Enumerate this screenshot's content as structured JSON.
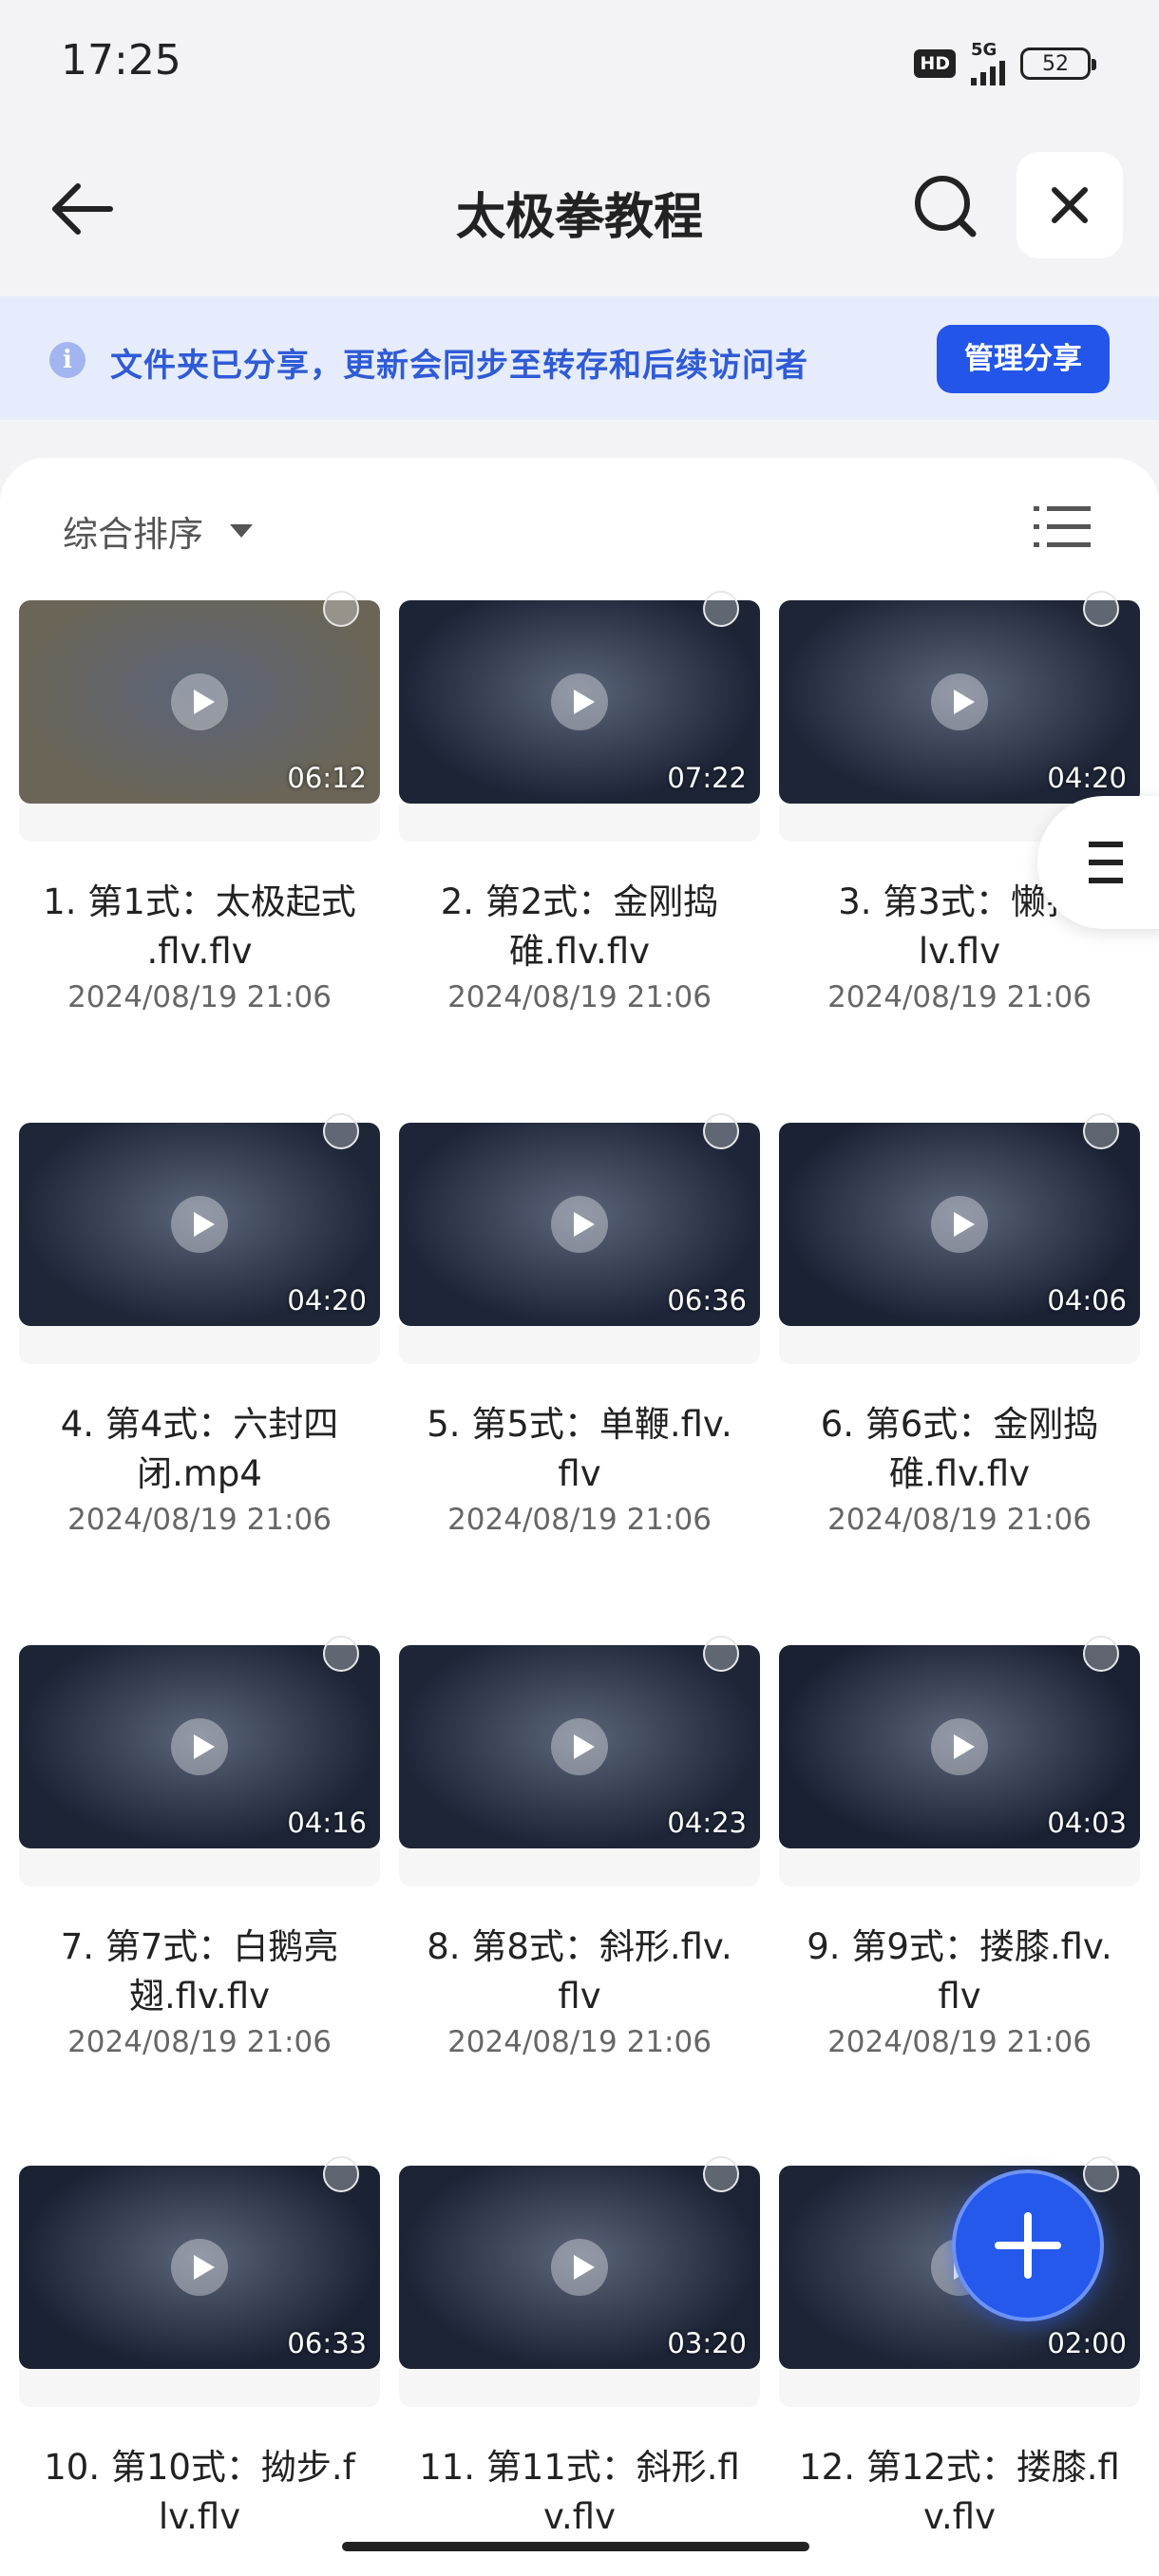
{
  "status_bar": {
    "time": "17:25",
    "hd_badge": "HD",
    "network": "5G",
    "battery": "52"
  },
  "header": {
    "title": "太极拳教程",
    "back_icon": "arrow-left-icon",
    "search_icon": "search-icon",
    "close_icon": "close-icon"
  },
  "banner": {
    "text": "文件夹已分享，更新会同步至转存和后续访问者",
    "button": "管理分享"
  },
  "sort": {
    "label": "综合排序"
  },
  "files": [
    {
      "name": "1. 第1式：太极起式.flv.flv",
      "line1": "1. 第1式：太极起式",
      "line2": ".flv.flv",
      "date": "2024/08/19 21:06",
      "duration": "06:12",
      "thumb_color": "#6b6558"
    },
    {
      "name": "2. 第2式：金刚捣碓.flv.flv",
      "line1": "2. 第2式：金刚捣",
      "line2": "碓.flv.flv",
      "date": "2024/08/19 21:06",
      "duration": "07:22",
      "thumb_color": "#1c2436"
    },
    {
      "name": "3. 第3式：懒扎衣.flv.flv",
      "line1": "3. 第3式：懒扎",
      "line2": "lv.flv",
      "date": "2024/08/19 21:06",
      "duration": "04:20",
      "thumb_color": "#1e2537"
    },
    {
      "name": "4. 第4式：六封四闭.mp4",
      "line1": "4. 第4式：六封四",
      "line2": "闭.mp4",
      "date": "2024/08/19 21:06",
      "duration": "04:20",
      "thumb_color": "#1e2638"
    },
    {
      "name": "5. 第5式：单鞭.flv.flv",
      "line1": "5. 第5式：单鞭.flv.",
      "line2": "flv",
      "date": "2024/08/19 21:06",
      "duration": "06:36",
      "thumb_color": "#1e2538"
    },
    {
      "name": "6. 第6式：金刚捣碓.flv.flv",
      "line1": "6. 第6式：金刚捣",
      "line2": "碓.flv.flv",
      "date": "2024/08/19 21:06",
      "duration": "04:06",
      "thumb_color": "#1b2234"
    },
    {
      "name": "7. 第7式：白鹅亮翅.flv.flv",
      "line1": "7. 第7式：白鹅亮",
      "line2": "翅.flv.flv",
      "date": "2024/08/19 21:06",
      "duration": "04:16",
      "thumb_color": "#1c2436"
    },
    {
      "name": "8. 第8式：斜形.flv.flv",
      "line1": "8. 第8式：斜形.flv.",
      "line2": "flv",
      "date": "2024/08/19 21:06",
      "duration": "04:23",
      "thumb_color": "#1d2537"
    },
    {
      "name": "9. 第9式：搂膝.flv.flv",
      "line1": "9. 第9式：搂膝.flv.",
      "line2": "flv",
      "date": "2024/08/19 21:06",
      "duration": "04:03",
      "thumb_color": "#1a2133"
    },
    {
      "name": "10. 第10式：拗步.flv.flv",
      "line1": "10. 第10式：拗步.f",
      "line2": "lv.flv",
      "date": "",
      "duration": "06:33",
      "thumb_color": "#1b2234"
    },
    {
      "name": "11. 第11式：斜形.flv.flv",
      "line1": "11. 第11式：斜形.fl",
      "line2": "v.flv",
      "date": "",
      "duration": "03:20",
      "thumb_color": "#1c2335"
    },
    {
      "name": "12. 第12式：搂膝.flv.flv",
      "line1": "12. 第12式：搂膝.fl",
      "line2": "v.flv",
      "date": "",
      "duration": "02:00",
      "thumb_color": "#1c2436"
    }
  ],
  "fab_icon": "plus-icon",
  "side_icon": "menu-icon"
}
